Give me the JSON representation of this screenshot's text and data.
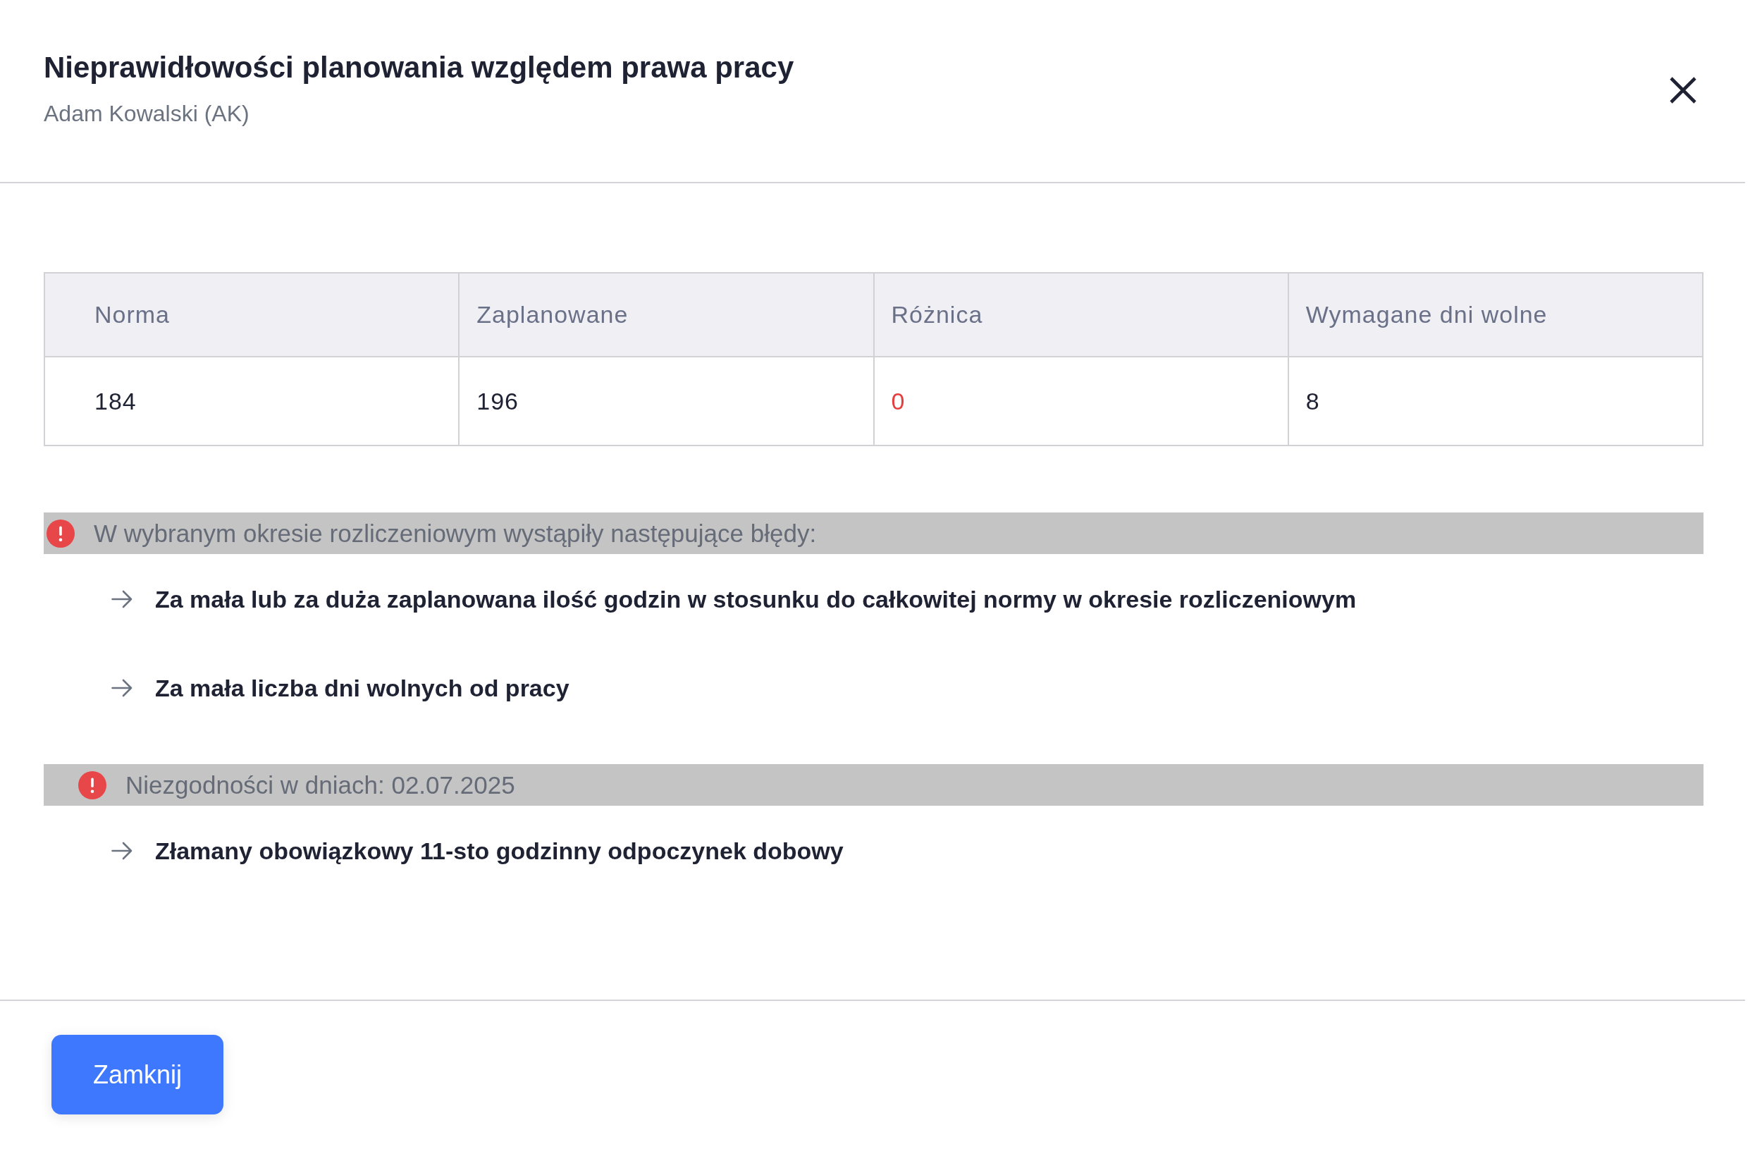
{
  "dialog": {
    "title": "Nieprawidłowości planowania względem prawa pracy",
    "subtitle": "Adam Kowalski (AK)"
  },
  "table": {
    "columns": [
      "Norma",
      "Zaplanowane",
      "Różnica",
      "Wymagane dni wolne"
    ],
    "rows": [
      {
        "cells": [
          {
            "text": "184",
            "flagged": false
          },
          {
            "text": "196",
            "flagged": false
          },
          {
            "text": "0",
            "flagged": true
          },
          {
            "text": "8",
            "flagged": false
          }
        ]
      }
    ]
  },
  "alerts": [
    {
      "kind": "period",
      "message": "W wybranym okresie rozliczeniowym wystąpiły następujące błędy:",
      "items": [
        "Za mała lub za duża zaplanowana ilość godzin w stosunku do całkowitej normy w okresie rozliczeniowym",
        "Za mała liczba dni wolnych od pracy"
      ]
    },
    {
      "kind": "days",
      "message": "Niezgodności w dniach: 02.07.2025",
      "items": [
        "Złamany obowiązkowy 11-sto godzinny odpoczynek dobowy"
      ]
    }
  ],
  "footer": {
    "button": "Zamknij"
  }
}
